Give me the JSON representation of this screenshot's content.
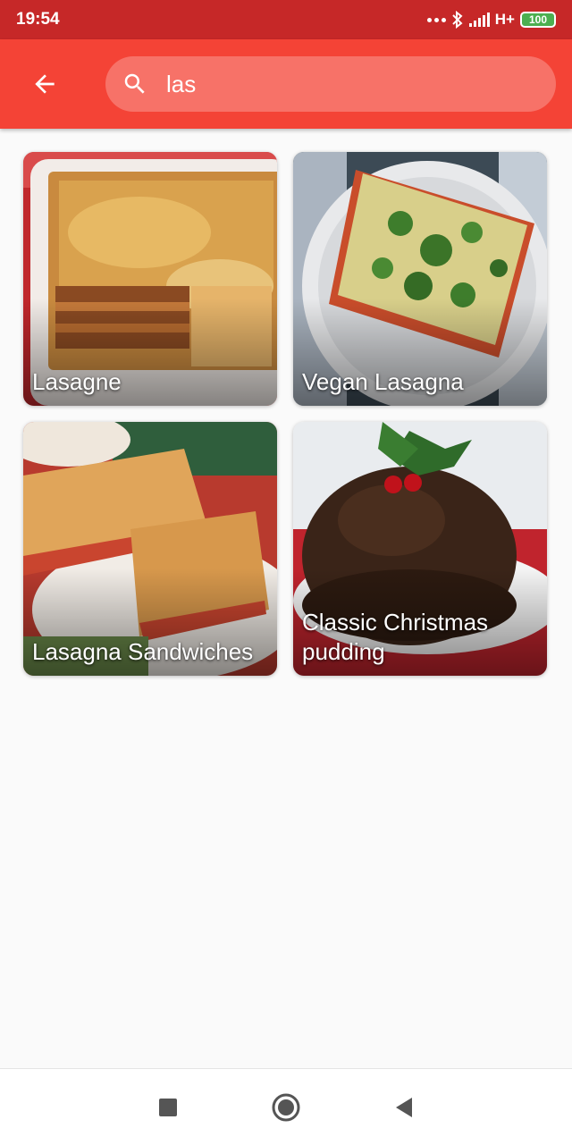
{
  "status_bar": {
    "time": "19:54",
    "network": "H+",
    "battery": "100"
  },
  "app_bar": {
    "search_value": "las",
    "background": "#f44336"
  },
  "results": [
    {
      "title": "Lasagne"
    },
    {
      "title": "Vegan Lasagna"
    },
    {
      "title": "Lasagna Sandwiches"
    },
    {
      "title": "Classic Christmas pudding"
    }
  ],
  "icons": {
    "back": "arrow-back-icon",
    "search": "search-icon",
    "recents": "square-icon",
    "home": "circle-icon",
    "back_nav": "triangle-icon"
  }
}
